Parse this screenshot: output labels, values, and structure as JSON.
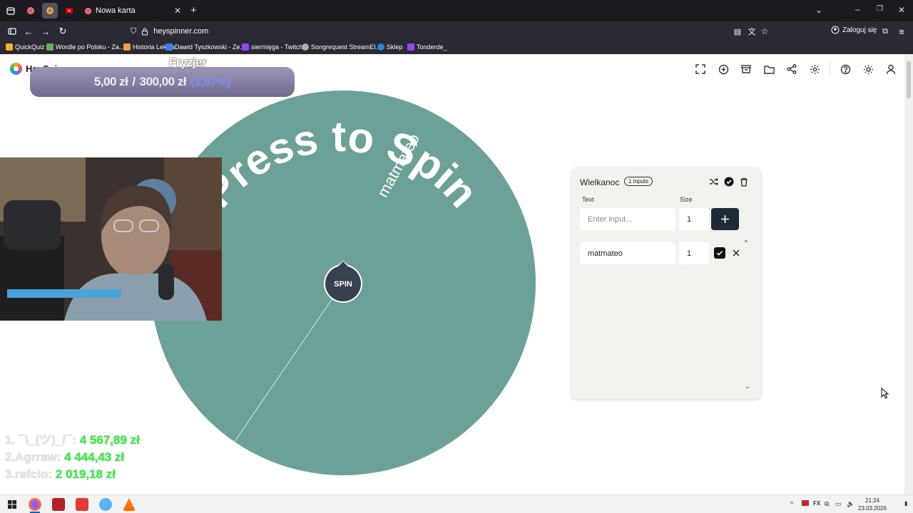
{
  "browser": {
    "active_tab_title": "Nowa karta",
    "url": "heyspinner.com",
    "login_label": "Zaloguj się",
    "bookmarks": [
      {
        "label": "QuickQuiz",
        "color": "#f0b429"
      },
      {
        "label": "Wordle po Polsku - Za...",
        "color": "#6aaa64"
      },
      {
        "label": "Historia Lekcja",
        "color": "#e6a23c"
      },
      {
        "label": "Dawid Tyszkowski - Ze...",
        "color": "#3b82f6"
      },
      {
        "label": "siermięga - Twitch",
        "color": "#9146ff"
      },
      {
        "label": "Songrequest StreamEl...",
        "color": "#aaaaaa"
      },
      {
        "label": "Sklep",
        "color": "#1e88e5"
      },
      {
        "label": "Tonderde_",
        "color": "#9146ff"
      }
    ]
  },
  "app": {
    "name": "HeySpinner",
    "toolbar_icons": [
      "fullscreen-icon",
      "add-circle-icon",
      "archive-icon",
      "folder-icon",
      "share-icon",
      "gear-icon",
      "help-icon",
      "sun-icon",
      "user-icon"
    ]
  },
  "wheel": {
    "color": "#6ba197",
    "prompt": "Press to Spin",
    "entry_label": "matmateo",
    "spin_label": "SPIN"
  },
  "panel": {
    "title": "Wielkanoc",
    "badge": "1 inputs",
    "text_header": "Text",
    "size_header": "Size",
    "input_placeholder": "Enter input...",
    "input_size": "1",
    "entries": [
      {
        "text": "matmateo",
        "size": "1",
        "checked": true
      }
    ]
  },
  "overlay": {
    "label": "Fryzjer",
    "donation_current": "5,00 zł",
    "donation_sep": "/",
    "donation_goal": "300,00 zł",
    "donation_percent": "(1,67%)",
    "donation_progress": 0.0167,
    "leaderboard": [
      {
        "name": "1. ¯\\_(ツ)_/¯:",
        "amount": "4 567,89 zł"
      },
      {
        "name": "2.Agrraw:",
        "amount": "4 444,43 zł"
      },
      {
        "name": "3.rafcio:",
        "amount": "2 019,18 zł"
      }
    ]
  },
  "taskbar": {
    "time": "21:24",
    "date": "23.03.2026"
  }
}
